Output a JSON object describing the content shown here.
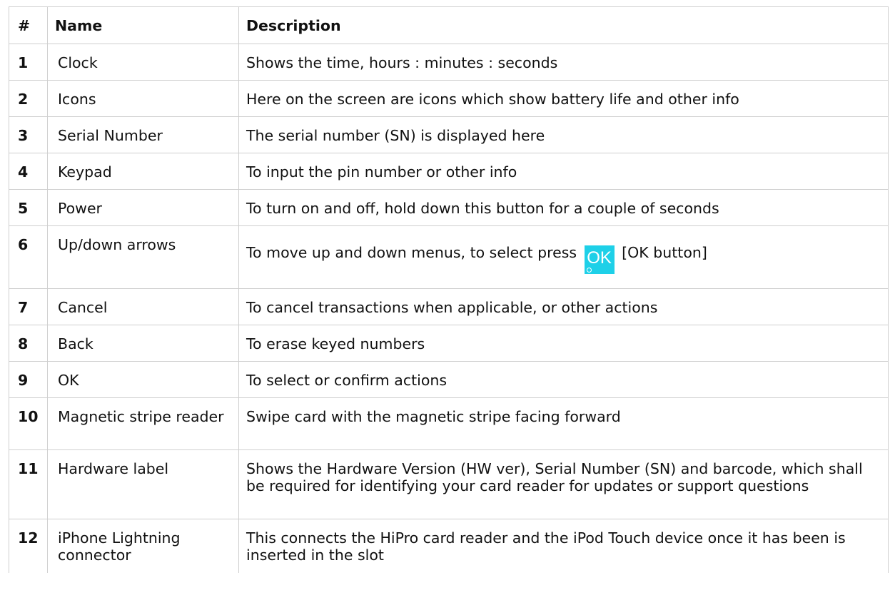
{
  "headers": {
    "num": "#",
    "name": "Name",
    "description": "Description"
  },
  "rows": [
    {
      "num": "1",
      "name": "Clock",
      "description": "Shows the time, hours : minutes : seconds"
    },
    {
      "num": "2",
      "name": "Icons",
      "description": "Here on the screen are icons which show battery life and other info"
    },
    {
      "num": "3",
      "name": "Serial Number",
      "description": "The serial number (SN) is displayed here"
    },
    {
      "num": "4",
      "name": "Keypad",
      "description": "To input the pin number or other info"
    },
    {
      "num": "5",
      "name": "Power",
      "description": "To turn on and off, hold down this button for a couple of seconds"
    },
    {
      "num": "6",
      "name": "Up/down arrows",
      "description": "To move up and down menus, to select press",
      "icon": "ok-button-icon",
      "icon_text": "OK",
      "icon_color": "#1ed0e8",
      "description_suffix": "[OK button]"
    },
    {
      "num": "7",
      "name": "Cancel",
      "description": "To cancel transactions when applicable, or other actions"
    },
    {
      "num": "8",
      "name": "Back",
      "description": "To erase keyed numbers"
    },
    {
      "num": "9",
      "name": "OK",
      "description": "To select or confirm actions"
    },
    {
      "num": "10",
      "name": "Magnetic stripe reader",
      "description": "Swipe card with the magnetic stripe facing forward"
    },
    {
      "num": "11",
      "name": "Hardware label",
      "description": "Shows the Hardware Version (HW ver), Serial Number (SN) and barcode, which shall be required for identifying your card reader for updates or support questions"
    },
    {
      "num": "12",
      "name": "iPhone Lightning connector",
      "description": "This connects the HiPro card reader and the iPod Touch device once it has been is inserted in the slot"
    }
  ],
  "colors": {
    "border": "#cfcfcf",
    "ok_icon": "#1ed0e8"
  }
}
